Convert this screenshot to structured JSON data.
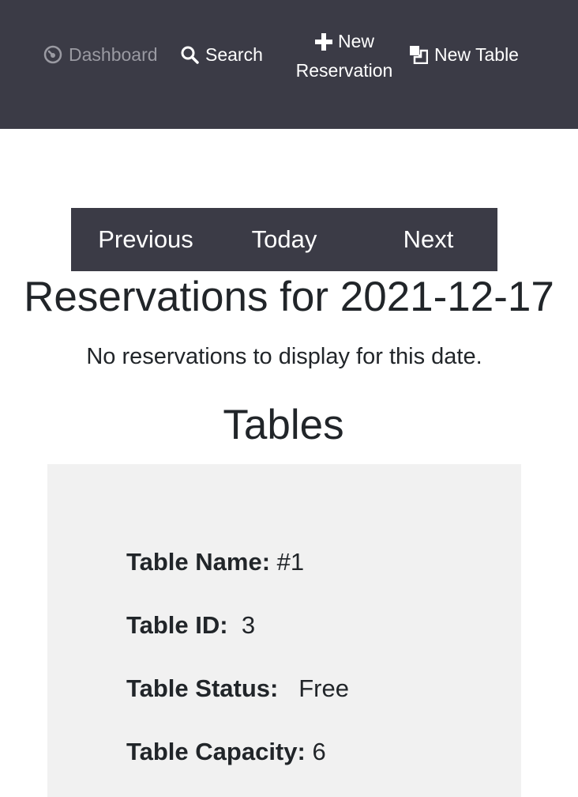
{
  "nav": {
    "dashboard_label": "Dashboard",
    "search_label": "Search",
    "new_reservation_line1": "New",
    "new_reservation_line2": "Reservation",
    "new_table_label": "New Table"
  },
  "date_nav": {
    "previous_label": "Previous",
    "today_label": "Today",
    "next_label": "Next"
  },
  "page_title": "Reservations for 2021-12-17",
  "reservations_empty_message": "No reservations to display for this date.",
  "tables_section": {
    "title": "Tables",
    "items": [
      {
        "name_label": "Table Name:",
        "name_value": "#1",
        "id_label": "Table ID:",
        "id_value": "3",
        "status_label": "Table Status:",
        "status_value": "Free",
        "capacity_label": "Table Capacity:",
        "capacity_value": "6"
      }
    ]
  },
  "colors": {
    "navbar_bg": "#3b3b46",
    "muted_text": "#9a9aa2",
    "card_bg": "#f1f1f1"
  },
  "icons": {
    "dashboard": "dashboard-gauge-icon",
    "search": "search-icon",
    "new_reservation": "plus-icon",
    "new_table": "new-table-icon"
  }
}
